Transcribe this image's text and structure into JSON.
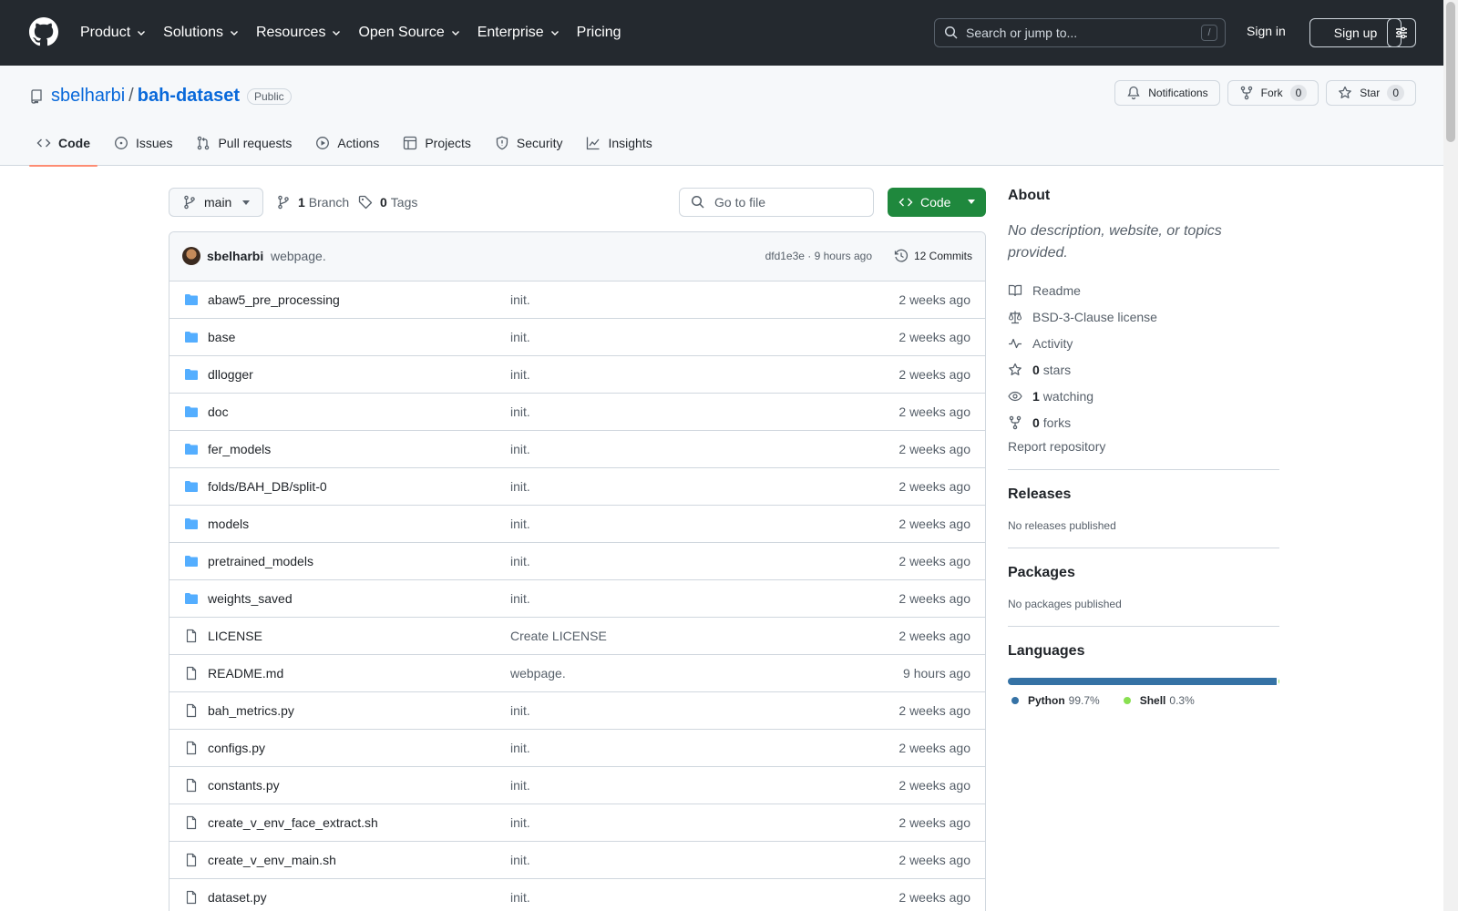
{
  "header": {
    "nav": [
      "Product",
      "Solutions",
      "Resources",
      "Open Source",
      "Enterprise",
      "Pricing"
    ],
    "search_placeholder": "Search or jump to...",
    "search_shortcut": "/",
    "sign_in": "Sign in",
    "sign_up": "Sign up"
  },
  "repo": {
    "owner": "sbelharbi",
    "separator": "/",
    "name": "bah-dataset",
    "visibility": "Public",
    "notifications_label": "Notifications",
    "fork_label": "Fork",
    "fork_count": "0",
    "star_label": "Star",
    "star_count": "0"
  },
  "tabs": [
    {
      "label": "Code",
      "icon": "code-icon",
      "active": true
    },
    {
      "label": "Issues",
      "icon": "issue-icon"
    },
    {
      "label": "Pull requests",
      "icon": "pull-request-icon"
    },
    {
      "label": "Actions",
      "icon": "play-icon"
    },
    {
      "label": "Projects",
      "icon": "table-icon"
    },
    {
      "label": "Security",
      "icon": "shield-icon"
    },
    {
      "label": "Insights",
      "icon": "graph-icon"
    }
  ],
  "toolbar": {
    "branch": "main",
    "branch_count": "1",
    "branch_label": "Branch",
    "tag_count": "0",
    "tag_label": "Tags",
    "go_to_file": "Go to file",
    "code_button": "Code"
  },
  "latest_commit": {
    "author": "sbelharbi",
    "message": "webpage.",
    "meta": "dfd1e3e · 9 hours ago",
    "commits_label": "12 Commits"
  },
  "files": [
    {
      "name": "abaw5_pre_processing",
      "type": "dir",
      "message": "init.",
      "date": "2 weeks ago"
    },
    {
      "name": "base",
      "type": "dir",
      "message": "init.",
      "date": "2 weeks ago"
    },
    {
      "name": "dllogger",
      "type": "dir",
      "message": "init.",
      "date": "2 weeks ago"
    },
    {
      "name": "doc",
      "type": "dir",
      "message": "init.",
      "date": "2 weeks ago"
    },
    {
      "name": "fer_models",
      "type": "dir",
      "message": "init.",
      "date": "2 weeks ago"
    },
    {
      "name": "folds/BAH_DB/split-0",
      "type": "dir",
      "message": "init.",
      "date": "2 weeks ago"
    },
    {
      "name": "models",
      "type": "dir",
      "message": "init.",
      "date": "2 weeks ago"
    },
    {
      "name": "pretrained_models",
      "type": "dir",
      "message": "init.",
      "date": "2 weeks ago"
    },
    {
      "name": "weights_saved",
      "type": "dir",
      "message": "init.",
      "date": "2 weeks ago"
    },
    {
      "name": "LICENSE",
      "type": "file",
      "message": "Create LICENSE",
      "date": "2 weeks ago"
    },
    {
      "name": "README.md",
      "type": "file",
      "message": "webpage.",
      "date": "9 hours ago"
    },
    {
      "name": "bah_metrics.py",
      "type": "file",
      "message": "init.",
      "date": "2 weeks ago"
    },
    {
      "name": "configs.py",
      "type": "file",
      "message": "init.",
      "date": "2 weeks ago"
    },
    {
      "name": "constants.py",
      "type": "file",
      "message": "init.",
      "date": "2 weeks ago"
    },
    {
      "name": "create_v_env_face_extract.sh",
      "type": "file",
      "message": "init.",
      "date": "2 weeks ago"
    },
    {
      "name": "create_v_env_main.sh",
      "type": "file",
      "message": "init.",
      "date": "2 weeks ago"
    },
    {
      "name": "dataset.py",
      "type": "file",
      "message": "init.",
      "date": "2 weeks ago"
    }
  ],
  "sidebar": {
    "about_title": "About",
    "about_desc": "No description, website, or topics provided.",
    "links": [
      {
        "icon": "book-icon",
        "bold": "",
        "text": "Readme"
      },
      {
        "icon": "law-icon",
        "bold": "",
        "text": "BSD-3-Clause license"
      },
      {
        "icon": "pulse-icon",
        "bold": "",
        "text": "Activity"
      },
      {
        "icon": "star-icon",
        "bold": "0",
        "text": "stars"
      },
      {
        "icon": "eye-icon",
        "bold": "1",
        "text": "watching"
      },
      {
        "icon": "fork-icon",
        "bold": "0",
        "text": "forks"
      }
    ],
    "report": "Report repository",
    "releases_title": "Releases",
    "releases_note": "No releases published",
    "packages_title": "Packages",
    "packages_note": "No packages published",
    "languages_title": "Languages",
    "languages": [
      {
        "name": "Python",
        "percent": "99.7%",
        "value": 99.7,
        "color": "#3572A5"
      },
      {
        "name": "Shell",
        "percent": "0.3%",
        "value": 0.3,
        "color": "#89e051"
      }
    ]
  },
  "colors": {
    "header_bg": "#24292f",
    "link": "#0969da",
    "code_button": "#1f883d",
    "active_tab_underline": "#fd8c73",
    "folder": "#54aeff"
  }
}
